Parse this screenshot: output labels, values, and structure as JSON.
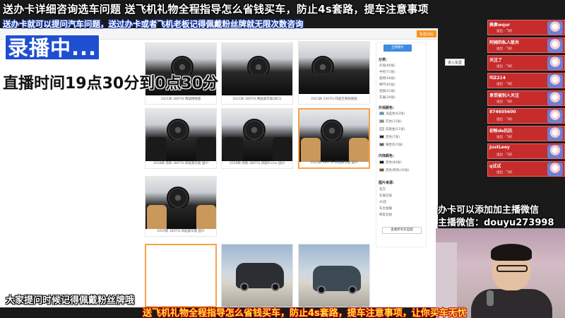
{
  "overlay": {
    "top_banner": "送办卡详细咨询选车问题  送飞机礼物全程指导怎么省钱买车，防止4s套路，提车注意事项",
    "second_banner": "送办卡就可以提问汽车问题，送过办卡或者飞机老板记得佩戴粉丝牌就无限次数咨询",
    "recording": "录播中...",
    "schedule": "直播时间19点30分到0点30分",
    "reminder": "大家提问时候记得佩戴粉丝牌哦",
    "bottom_banner": "送飞机礼物全程指导怎么省钱买车，防止4s套路，提车注意事项，让你买车无忧",
    "wechat_line1": "办卡可以添加加主播微信",
    "wechat_line2": "主播微信：douyu273998"
  },
  "site": {
    "header_buttons": [
      "车型对比",
      "进入车型",
      "参数配置",
      "4S报价"
    ],
    "view_all_label": "全部图片",
    "filter_sections": {
      "categories_title": "分类：",
      "categories": [
        "外观(80张)",
        "中控(71张)",
        "座椅(68张)",
        "细节(85张)",
        "官图(41张)",
        "车展(26张)"
      ],
      "exterior_title": "外观颜色：",
      "exterior_colors": [
        {
          "label": "浅蓝色(62张)",
          "color": "#5a8fbf"
        },
        {
          "label": "灰色(15张)",
          "color": "#8a8d91"
        },
        {
          "label": "白银金(11张)",
          "color": "#d8d6cf"
        },
        {
          "label": "黑色(7张)",
          "color": "#2a2a2a"
        },
        {
          "label": "曜岩灰(5张)",
          "color": "#5f6368"
        }
      ],
      "interior_title": "内饰颜色：",
      "interior_colors": [
        {
          "label": "黑色(84张)",
          "color": "#1a1a1a"
        },
        {
          "label": "黑色/棕色(34张)",
          "color": "#7a4b2a"
        }
      ],
      "dealer_title": "图片来源：",
      "dealers": [
        "官方",
        "车展实拍",
        "4S店",
        "车主拍摄",
        "网友实拍"
      ],
      "config_button": "查看所有车型配"
    },
    "thumbnails": [
      {
        "caption": "2021款 280TSI 两驱精致版",
        "kind": "interior"
      },
      {
        "caption": "2021款 280TSI 两驱豪华版(进口)",
        "kind": "interior"
      },
      {
        "caption": "2021款 330TSI 四驱至尊旗舰版",
        "kind": "interior"
      },
      {
        "caption": "2018款 改款 380TSI 四驱豪华版 国VI",
        "kind": "interior"
      },
      {
        "caption": "2019款 改款 380TSI 四驱R-Line 国VI",
        "kind": "interior"
      },
      {
        "caption": "2020款 380TSI 四驱豪华版 国VI",
        "kind": "interior"
      },
      {
        "caption": "2019款 380TSI 四驱豪华版 国VI",
        "kind": "interior"
      },
      {
        "caption": "",
        "kind": "blank"
      },
      {
        "caption": "",
        "kind": "exterior"
      },
      {
        "caption": "",
        "kind": "exterior"
      }
    ]
  },
  "chat": [
    {
      "name": "佩奥wqur",
      "sub": "送出 · 飞机"
    },
    {
      "name": "阿姆的私人联关",
      "sub": "送出 · 飞机"
    },
    {
      "name": "关注了",
      "sub": "送出 · 飞机"
    },
    {
      "name": "叫Z214",
      "sub": "送出 · 飞机"
    },
    {
      "name": "享受被别人关注",
      "sub": "送出 · 飞机"
    },
    {
      "name": "874605600",
      "sub": "送出 · 飞机"
    },
    {
      "name": "初帐de抗抗",
      "sub": "送出 · 飞机"
    },
    {
      "name": "JustLeey",
      "sub": "送出 · 飞机"
    },
    {
      "name": "q试试",
      "sub": "送出 · 飞机"
    }
  ],
  "colors": {
    "accent_orange": "#f7931e",
    "chat_red": "#c62c2c",
    "overlay_blue": "#1b3ea8"
  }
}
